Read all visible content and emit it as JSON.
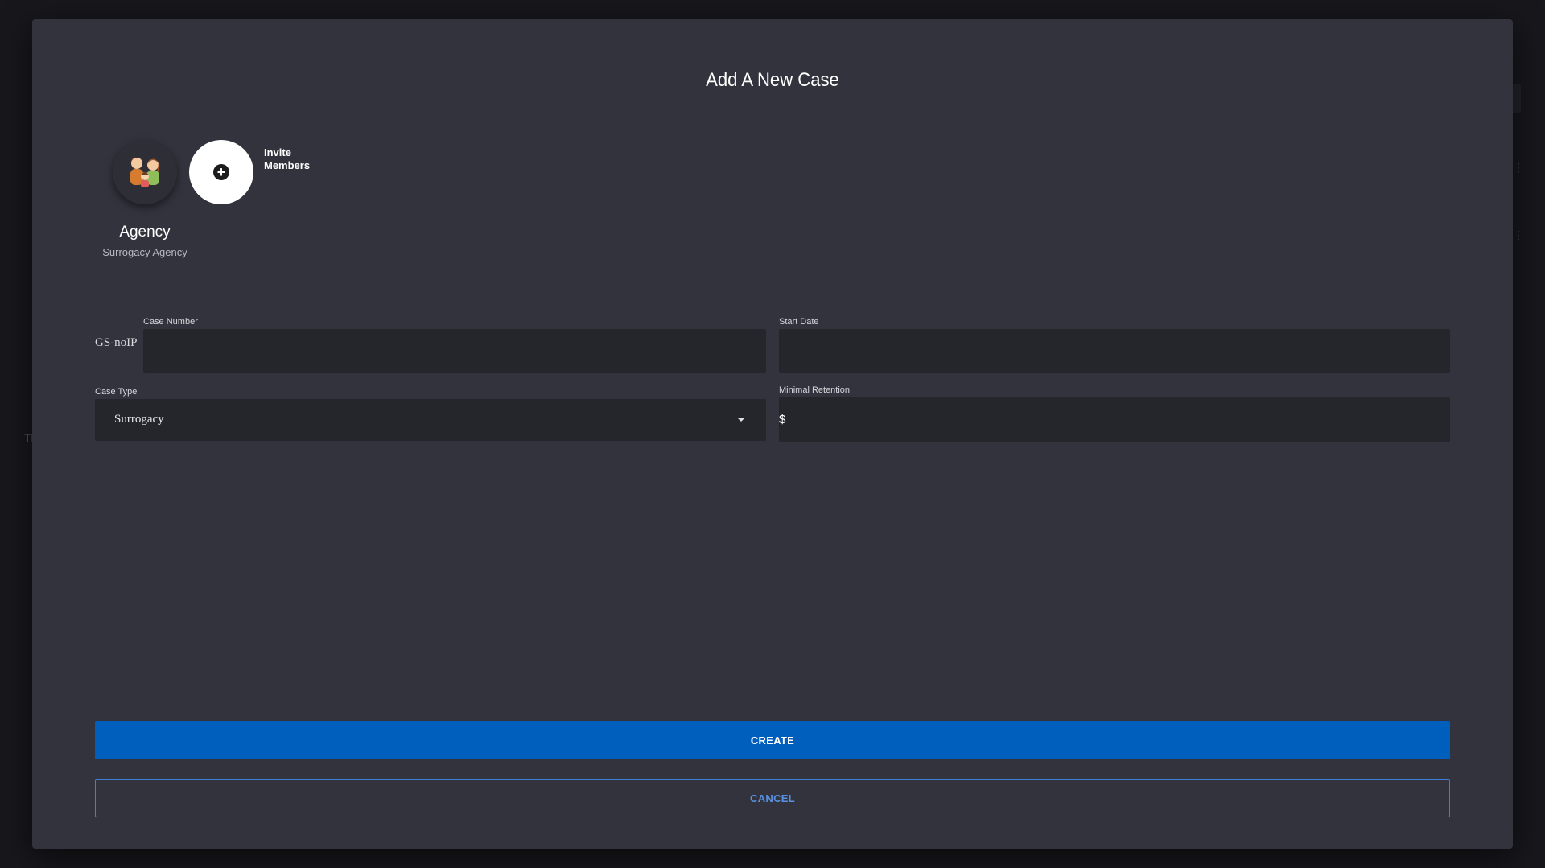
{
  "background": {
    "hint_text": "Th"
  },
  "modal": {
    "title": "Add A New Case"
  },
  "members": {
    "avatar_icon": "family-avatar-icon",
    "invite_label": "Invite Members",
    "agency_name": "Agency",
    "agency_type": "Surrogacy Agency"
  },
  "form": {
    "case_number": {
      "label": "Case Number",
      "prefix": "GS-noIP",
      "value": ""
    },
    "start_date": {
      "label": "Start Date",
      "value": ""
    },
    "case_type": {
      "label": "Case Type",
      "selected": "Surrogacy"
    },
    "minimal_retention": {
      "label": "Minimal Retention",
      "currency": "$",
      "value": ""
    }
  },
  "actions": {
    "create_label": "CREATE",
    "cancel_label": "CANCEL"
  },
  "colors": {
    "modal_bg": "#33333d",
    "field_bg": "#25252c",
    "primary": "#005ebd",
    "cancel_text": "#5891e2"
  }
}
